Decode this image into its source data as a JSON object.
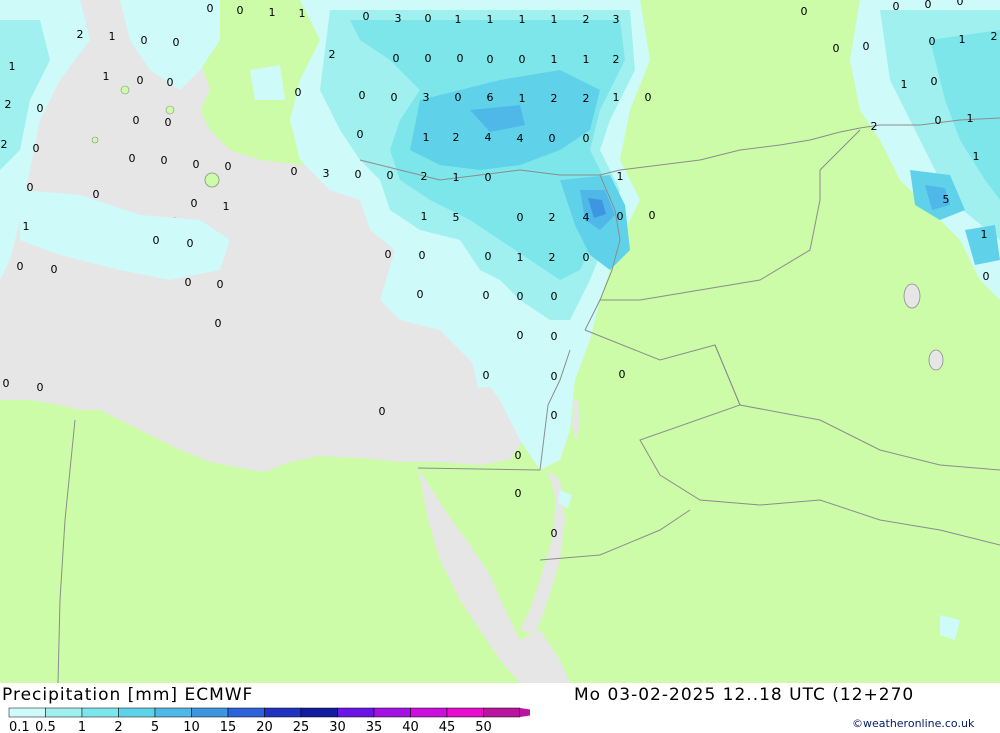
{
  "title": {
    "product": "Precipitation [mm]",
    "model": "ECMWF",
    "valid": "Mo 03-02-2025 12..18 UTC (12+270"
  },
  "legend": {
    "ticks": [
      "0.1",
      "0.5",
      "1",
      "2",
      "5",
      "10",
      "15",
      "20",
      "25",
      "30",
      "35",
      "40",
      "45",
      "50"
    ],
    "colors": [
      "#cffafa",
      "#a0f0f0",
      "#7de6ea",
      "#5fd2ea",
      "#4fb8e8",
      "#3f96e0",
      "#2e62d8",
      "#2034c0",
      "#121c9c",
      "#6b14e6",
      "#a212e0",
      "#cc10dc",
      "#e80ccc",
      "#b8149e"
    ]
  },
  "credit": "©weatheronline.co.uk",
  "map_colors": {
    "land": "#ccfca8",
    "sea": "#e6e6e6",
    "precip_light": "#cffafa",
    "precip_mid": "#a0f0f0",
    "precip_heavy": "#5fd2ea",
    "precip_max": "#3f96e0",
    "border": "#8c8c8c"
  },
  "values": [
    "0",
    "1",
    "2",
    "3",
    "4",
    "5",
    "6"
  ]
}
